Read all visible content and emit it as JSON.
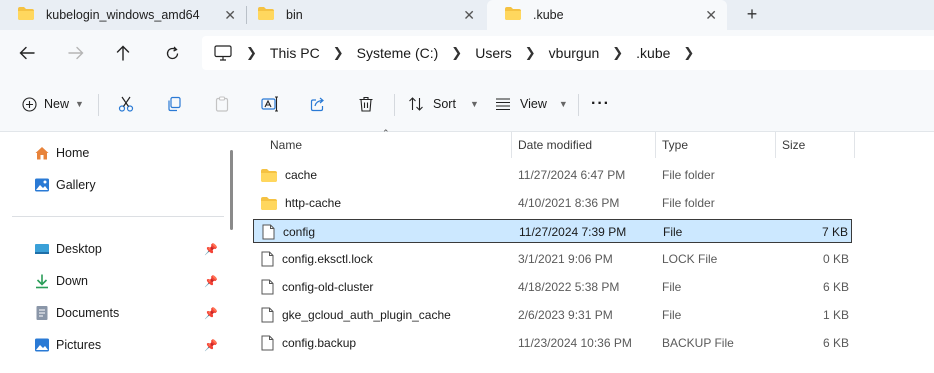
{
  "tabs": [
    {
      "label": "kubelogin_windows_amd64",
      "active": false
    },
    {
      "label": "bin",
      "active": false
    },
    {
      "label": ".kube",
      "active": true
    }
  ],
  "tab_add_symbol": "+",
  "tab_close_symbol": "✕",
  "breadcrumbs": [
    "This PC",
    "Systeme (C:)",
    "Users",
    "vburgun",
    ".kube"
  ],
  "toolbar": {
    "new_label": "New",
    "sort_label": "Sort",
    "view_label": "View",
    "more_label": "···"
  },
  "nav_pane": {
    "top_items": [
      {
        "label": "Home",
        "icon": "home-icon"
      },
      {
        "label": "Gallery",
        "icon": "gallery-icon"
      }
    ],
    "pinned_items": [
      {
        "label": "Desktop",
        "icon": "desktop-icon"
      },
      {
        "label": "Down",
        "icon": "download-icon"
      },
      {
        "label": "Documents",
        "icon": "documents-icon"
      },
      {
        "label": "Pictures",
        "icon": "pictures-icon"
      }
    ]
  },
  "columns": {
    "name": "Name",
    "date": "Date modified",
    "type": "Type",
    "size": "Size"
  },
  "files": [
    {
      "name": "cache",
      "date": "11/27/2024 6:47 PM",
      "type": "File folder",
      "size": "",
      "kind": "folder",
      "selected": false
    },
    {
      "name": "http-cache",
      "date": "4/10/2021 8:36 PM",
      "type": "File folder",
      "size": "",
      "kind": "folder",
      "selected": false
    },
    {
      "name": "config",
      "date": "11/27/2024 7:39 PM",
      "type": "File",
      "size": "7 KB",
      "kind": "file",
      "selected": true
    },
    {
      "name": "config.eksctl.lock",
      "date": "3/1/2021 9:06 PM",
      "type": "LOCK File",
      "size": "0 KB",
      "kind": "file",
      "selected": false
    },
    {
      "name": "config-old-cluster",
      "date": "4/18/2022 5:38 PM",
      "type": "File",
      "size": "6 KB",
      "kind": "file",
      "selected": false
    },
    {
      "name": "gke_gcloud_auth_plugin_cache",
      "date": "2/6/2023 9:31 PM",
      "type": "File",
      "size": "1 KB",
      "kind": "file",
      "selected": false
    },
    {
      "name": "config.backup",
      "date": "11/23/2024 10:36 PM",
      "type": "BACKUP File",
      "size": "6 KB",
      "kind": "file",
      "selected": false
    }
  ],
  "colors": {
    "folder": "#f5c242",
    "selection": "#cce8ff",
    "chrome_bg": "#f7f9fb",
    "tab_bg": "#e9eef4",
    "accent_blue": "#2a7ad5"
  }
}
